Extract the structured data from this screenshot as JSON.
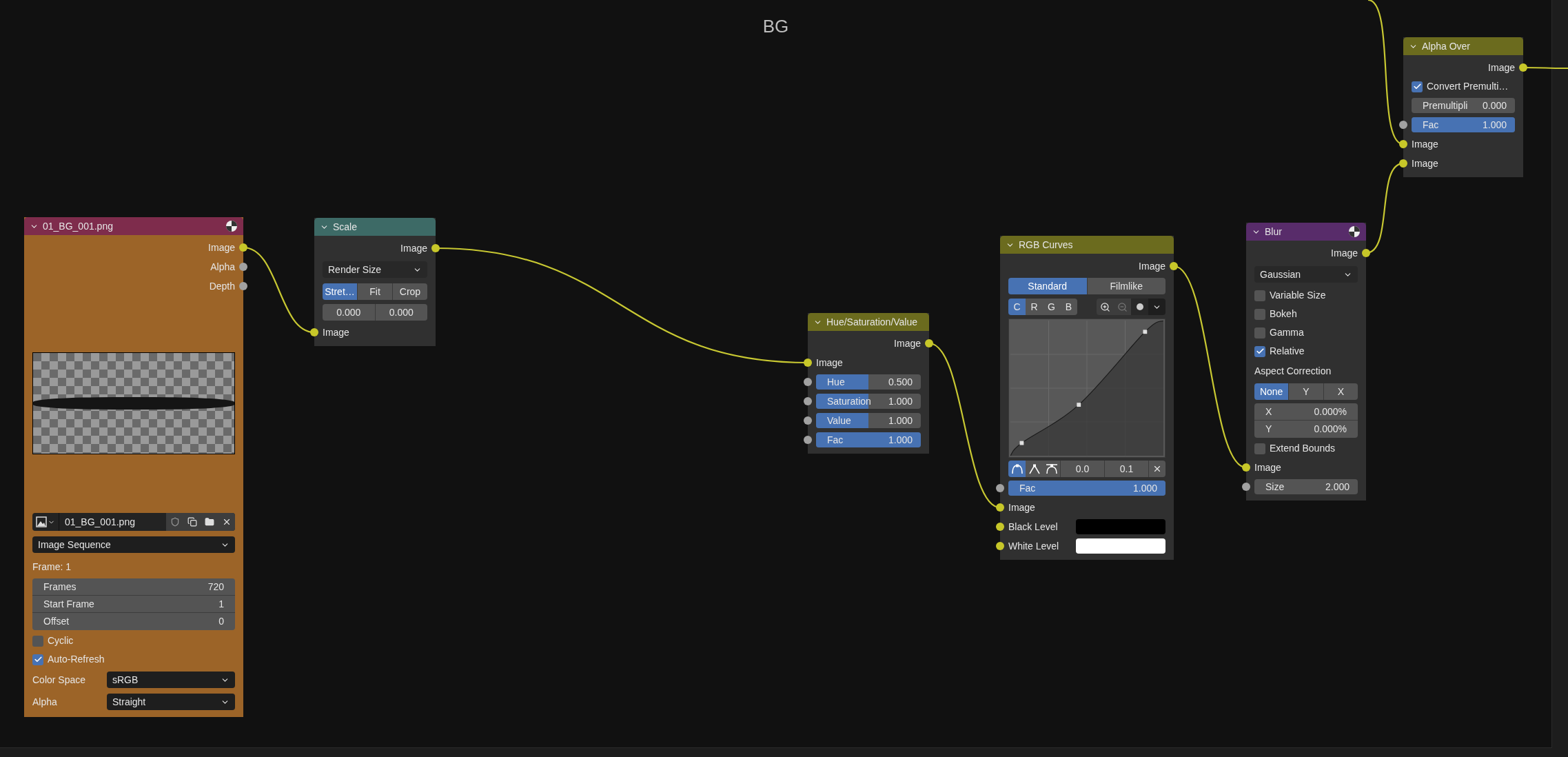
{
  "frame": {
    "title": "BG"
  },
  "nodes": [
    {
      "title": "01_BG_001.png",
      "color": "#7e2c4c",
      "body": {
        "color": "#9c6428"
      },
      "icon": true,
      "rows": [
        {
          "kind": "output",
          "label": "Image",
          "color": "#c7c729"
        },
        {
          "kind": "output",
          "label": "Alpha",
          "color": "#a1a1a1"
        },
        {
          "kind": "output",
          "label": "Depth",
          "color": "#a1a1a1"
        },
        {
          "kind": "preview"
        },
        {
          "kind": "image_selector",
          "filename": "01_BG_001.png"
        },
        {
          "kind": "dropdown",
          "value": "Image Sequence"
        },
        {
          "kind": "label",
          "text": "Frame: 1"
        },
        {
          "kind": "fields",
          "fields": [
            {
              "label": "Frames",
              "value": "720"
            },
            {
              "label": "Start Frame",
              "value": "1"
            },
            {
              "label": "Offset",
              "value": "0"
            }
          ]
        },
        {
          "kind": "checkbox",
          "label": "Cyclic",
          "checked": false
        },
        {
          "kind": "checkbox",
          "label": "Auto-Refresh",
          "checked": true
        },
        {
          "kind": "labeled_dropdown",
          "label": "Color Space",
          "value": "sRGB"
        },
        {
          "kind": "labeled_dropdown",
          "label": "Alpha",
          "value": "Straight"
        }
      ]
    },
    {
      "title": "Scale",
      "color": "#3d6a66",
      "rows": [
        {
          "kind": "output",
          "label": "Image",
          "color": "#c7c729"
        },
        {
          "kind": "dropdown",
          "value": "Render Size"
        },
        {
          "kind": "segmented",
          "options": [
            {
              "label": "Stret…",
              "selected": true
            },
            {
              "label": "Fit",
              "selected": false
            },
            {
              "label": "Crop",
              "selected": false
            }
          ]
        },
        {
          "kind": "number_pair",
          "values": [
            "0.000",
            "0.000"
          ]
        },
        {
          "kind": "input",
          "label": "Image",
          "color": "#c7c729"
        }
      ]
    },
    {
      "title": "Hue/Saturation/Value",
      "color": "#6b6b1e",
      "rows": [
        {
          "kind": "output",
          "label": "Image",
          "color": "#c7c729"
        },
        {
          "kind": "input",
          "label": "Image",
          "color": "#c7c729"
        },
        {
          "kind": "slider",
          "label": "Hue",
          "value": "0.500",
          "level": 0.5,
          "color": "#a1a1a1"
        },
        {
          "kind": "slider",
          "label": "Saturation",
          "value": "1.000",
          "level": 0.5,
          "color": "#a1a1a1"
        },
        {
          "kind": "slider",
          "label": "Value",
          "value": "1.000",
          "level": 0.5,
          "color": "#a1a1a1"
        },
        {
          "kind": "slider",
          "label": "Fac",
          "value": "1.000",
          "level": 1,
          "color": "#a1a1a1"
        }
      ]
    },
    {
      "title": "RGB Curves",
      "color": "#6b6b1e",
      "rows": [
        {
          "kind": "output",
          "label": "Image",
          "color": "#c7c729"
        },
        {
          "kind": "segmented",
          "options": [
            {
              "label": "Standard",
              "selected": true
            },
            {
              "label": "Filmlike",
              "selected": false
            }
          ]
        },
        {
          "kind": "curve",
          "channels": [
            {
              "label": "C",
              "selected": true
            },
            {
              "label": "R",
              "selected": false
            },
            {
              "label": "G",
              "selected": false
            },
            {
              "label": "B",
              "selected": false
            }
          ],
          "handle_types": [
            {
              "selected": true
            },
            {
              "selected": false
            },
            {
              "selected": false
            }
          ],
          "values": [
            "0.0",
            "0.1"
          ]
        },
        {
          "kind": "slider",
          "label": "Fac",
          "value": "1.000",
          "level": 1,
          "color": "#a1a1a1"
        },
        {
          "kind": "input",
          "label": "Image",
          "color": "#c7c729"
        },
        {
          "kind": "color_input",
          "label": "Black Level",
          "color": "#c7c729",
          "swatch": {
            "color": "#000000"
          }
        },
        {
          "kind": "color_input",
          "label": "White Level",
          "color": "#c7c729",
          "swatch": {
            "color": "#ffffff"
          }
        }
      ]
    },
    {
      "title": "Blur",
      "color": "#582c6a",
      "icon": true,
      "rows": [
        {
          "kind": "output",
          "label": "Image",
          "color": "#c7c729"
        },
        {
          "kind": "dropdown",
          "value": "Gaussian"
        },
        {
          "kind": "checkbox",
          "label": "Variable Size",
          "checked": false
        },
        {
          "kind": "checkbox",
          "label": "Bokeh",
          "checked": false
        },
        {
          "kind": "checkbox",
          "label": "Gamma",
          "checked": false
        },
        {
          "kind": "checkbox",
          "label": "Relative",
          "checked": true
        },
        {
          "kind": "label",
          "text": "Aspect Correction"
        },
        {
          "kind": "segmented",
          "options": [
            {
              "label": "None",
              "selected": true
            },
            {
              "label": "Y",
              "selected": false
            },
            {
              "label": "X",
              "selected": false
            }
          ]
        },
        {
          "kind": "fields",
          "fields": [
            {
              "label": "X",
              "value": "0.000%"
            },
            {
              "label": "Y",
              "value": "0.000%"
            }
          ]
        },
        {
          "kind": "checkbox",
          "label": "Extend Bounds",
          "checked": false
        },
        {
          "kind": "input",
          "label": "Image",
          "color": "#c7c729"
        },
        {
          "kind": "number",
          "label": "Size",
          "value": "2.000",
          "color": "#a1a1a1"
        }
      ]
    },
    {
      "title": "Alpha Over",
      "color": "#6b6b1e",
      "rows": [
        {
          "kind": "output",
          "label": "Image",
          "color": "#c7c729"
        },
        {
          "kind": "checkbox",
          "label": "Convert Premulti…",
          "checked": true
        },
        {
          "kind": "number",
          "label": "Premultipli",
          "value": "0.000"
        },
        {
          "kind": "slider",
          "label": "Fac",
          "value": "1.000",
          "level": 1,
          "color": "#a1a1a1"
        },
        {
          "kind": "input",
          "label": "Image",
          "color": "#c7c729"
        },
        {
          "kind": "input",
          "label": "Image",
          "color": "#c7c729"
        }
      ]
    }
  ]
}
